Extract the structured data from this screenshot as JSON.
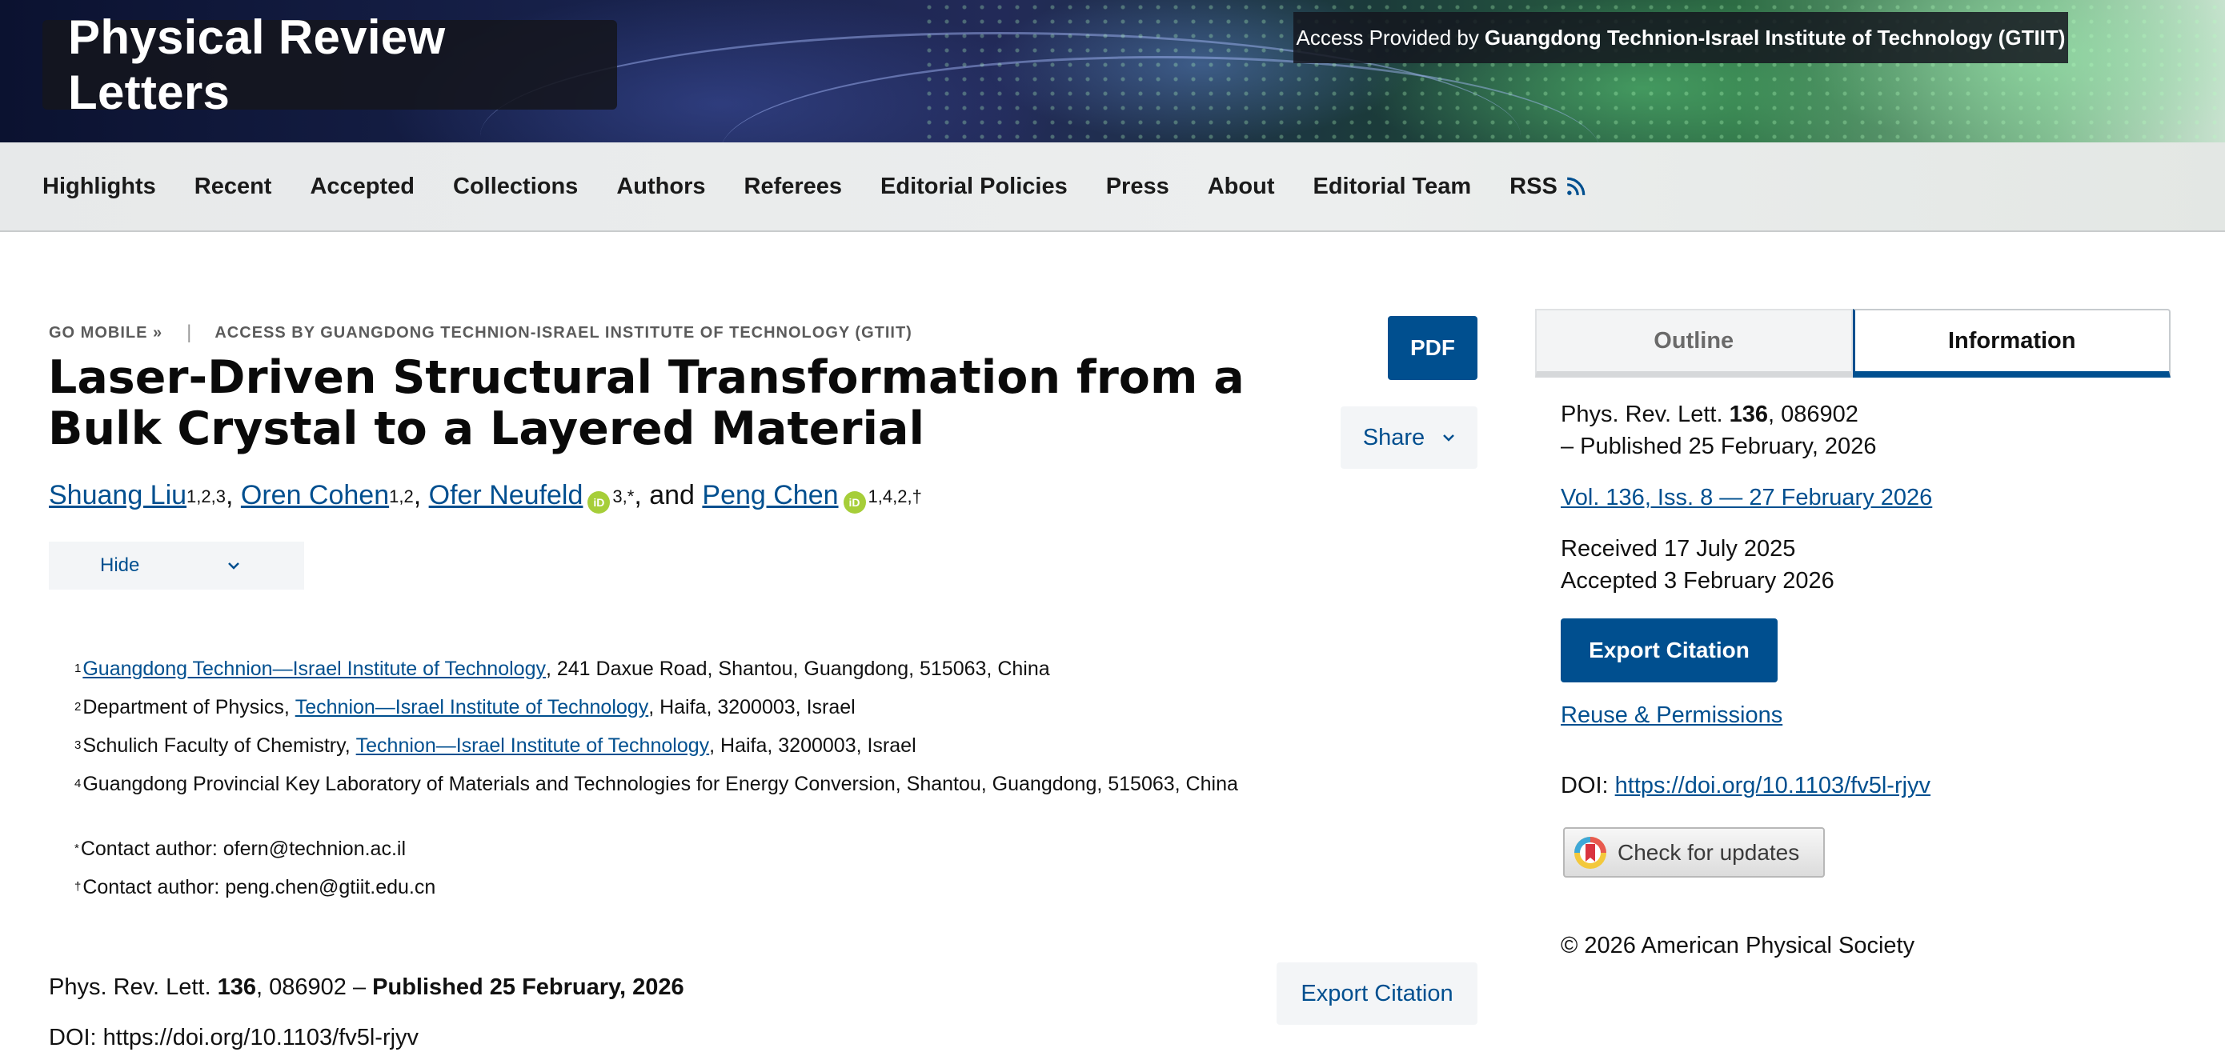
{
  "header": {
    "journal_title": "Physical Review Letters",
    "access_prefix": "Access Provided by",
    "access_institution": "Guangdong Technion-Israel Institute of Technology (GTIIT)"
  },
  "nav": {
    "items": [
      "Highlights",
      "Recent",
      "Accepted",
      "Collections",
      "Authors",
      "Referees",
      "Editorial Policies",
      "Press",
      "About",
      "Editorial Team",
      "RSS"
    ],
    "rss_icon": "rss-icon"
  },
  "breadcrumb": {
    "go_mobile": "GO MOBILE »",
    "access": "ACCESS BY GUANGDONG TECHNION-ISRAEL INSTITUTE OF TECHNOLOGY (GTIIT)"
  },
  "actions": {
    "pdf": "PDF",
    "share": "Share",
    "hide": "Hide",
    "export_citation": "Export Citation"
  },
  "article": {
    "title": "Laser-Driven Structural Transformation from a Bulk Crystal to a Layered Material",
    "authors": [
      {
        "name": "Shuang Liu",
        "sup": "1,2,3",
        "orcid": false
      },
      {
        "name": "Oren Cohen",
        "sup": "1,2",
        "orcid": false
      },
      {
        "name": "Ofer Neufeld",
        "sup": "3,*",
        "orcid": true
      },
      {
        "name": "Peng Chen",
        "sup": "1,4,2,†",
        "orcid": true
      }
    ],
    "author_separator": ", ",
    "author_and": ", and ",
    "orcid_label": "iD",
    "affiliations": [
      {
        "num": "1",
        "link": "Guangdong Technion—Israel Institute of Technology",
        "before": "",
        "after": ", 241 Daxue Road, Shantou, Guangdong, 515063, China"
      },
      {
        "num": "2",
        "link": "Technion—Israel Institute of Technology",
        "before": "Department of Physics, ",
        "after": ", Haifa, 3200003, Israel"
      },
      {
        "num": "3",
        "link": "Technion—Israel Institute of Technology",
        "before": "Schulich Faculty of Chemistry, ",
        "after": ", Haifa, 3200003, Israel"
      },
      {
        "num": "4",
        "link": "",
        "before": "Guangdong Provincial Key Laboratory of Materials and Technologies for Energy Conversion, Shantou, Guangdong, 515063, China",
        "after": ""
      }
    ],
    "contacts": [
      {
        "mark": "*",
        "text": "Contact author: ofern@technion.ac.il"
      },
      {
        "mark": "†",
        "text": "Contact author: peng.chen@gtiit.edu.cn"
      }
    ],
    "citation": {
      "journal": "Phys. Rev. Lett. ",
      "volume": "136",
      "article": ", 086902 – ",
      "published": "Published 25 February, 2026"
    },
    "doi_line": "DOI: https://doi.org/10.1103/fv5l-rjyv"
  },
  "sidebar": {
    "tabs": [
      "Outline",
      "Information"
    ],
    "active_tab": "Information",
    "journal": "Phys. Rev. Lett. ",
    "volume": "136",
    "article_no": ", 086902",
    "published": "– Published 25 February, 2026",
    "issue_link": "Vol. 136, Iss. 8 — 27 February 2026",
    "received": "Received 17 July 2025",
    "accepted": "Accepted 3 February 2026",
    "export_citation": "Export Citation",
    "reuse": "Reuse & Permissions",
    "doi_label": "DOI: ",
    "doi_url": "https://doi.org/10.1103/fv5l-rjyv",
    "check_updates": "Check for updates",
    "copyright": "© 2026 American Physical Society"
  },
  "colors": {
    "link": "#004f8f",
    "primary_button": "#004f8f",
    "orcid": "#a6ce39"
  }
}
